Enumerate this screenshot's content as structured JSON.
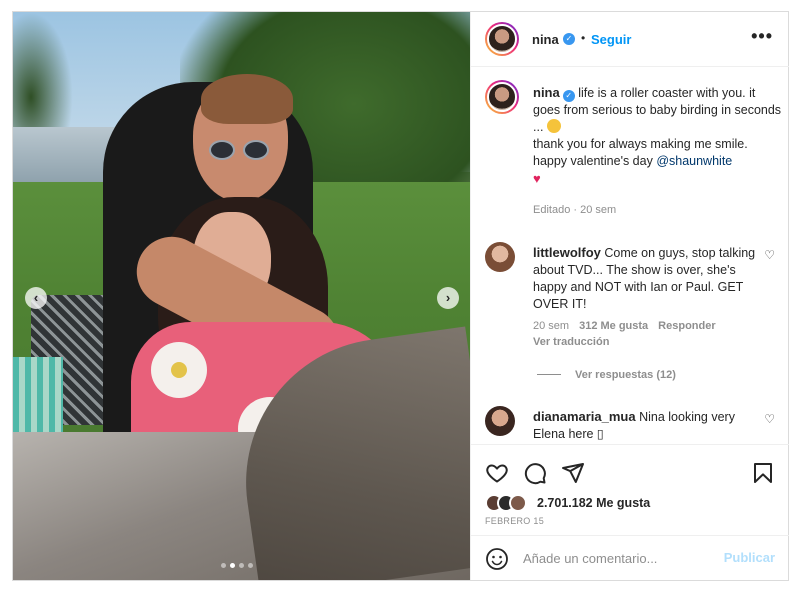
{
  "post": {
    "username": "nina",
    "verified": true,
    "header_separator": "•",
    "follow_label": "Seguir",
    "more_label": "•••",
    "photo_nav": {
      "prev": "‹",
      "next": "›",
      "slides": 4,
      "active_slide": 1
    }
  },
  "caption": {
    "username": "nina",
    "line1": " life is a roller coaster with you. it goes from serious to baby birding in seconds ... ",
    "line2": "thank you for always making me smile.",
    "line3_prefix": "happy valentine's day ",
    "mention": "@shaunwhite",
    "emoji_laugh": "zany-face-emoji",
    "emoji_heart": "♥",
    "edited": "Editado",
    "time": "20 sem"
  },
  "comments": [
    {
      "username": "littlewolfoy",
      "text": " Come on guys, stop talking about TVD... The show is over, she's happy and NOT with Ian or Paul. GET OVER IT!",
      "time": "20 sem",
      "likes": "312 Me gusta",
      "reply_label": "Responder",
      "translate_label": "Ver traducción",
      "view_replies": "Ver respuestas (12)",
      "avatar_color": "#b98a6e"
    },
    {
      "username": "dianamaria_mua",
      "text": " Nina looking very Elena here ▯",
      "avatar_color": "#6b4b3e"
    }
  ],
  "actions": {
    "like_icon": "heart-icon",
    "comment_icon": "comment-icon",
    "share_icon": "share-icon",
    "save_icon": "bookmark-icon",
    "likes_count": "2.701.182",
    "likes_suffix": " Me gusta",
    "liker_avatar_colors": [
      "#5a3d33",
      "#2b2b2b",
      "#7d5a4a"
    ],
    "date": "FEBRERO 15"
  },
  "comment_box": {
    "emoji_icon": "smiley-icon",
    "placeholder": "Añade un comentario...",
    "post_label": "Publicar"
  },
  "colors": {
    "accent": "#0095f6",
    "verified": "#3897f0",
    "post_disabled": "#b2dffc",
    "muted": "#8e8e8e"
  }
}
